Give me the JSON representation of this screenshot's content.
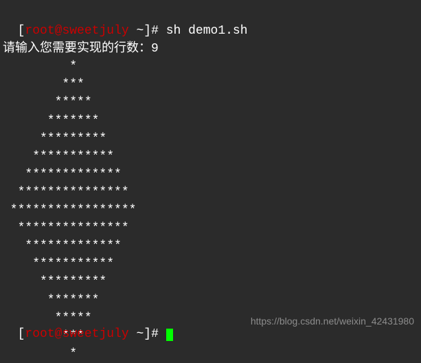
{
  "prompt": {
    "open_bracket": "[",
    "user": "root",
    "at": "@",
    "host": "sweetjuly",
    "space_path": " ~",
    "close_bracket": "]",
    "hash": "# "
  },
  "command": "sh demo1.sh",
  "input_prompt": "请输入您需要实现的行数：9",
  "pattern": {
    "lines": [
      "         *",
      "        ***",
      "       *****",
      "      *******",
      "     *********",
      "    ***********",
      "   *************",
      "  ***************",
      " *****************",
      "  ***************",
      "   *************",
      "    ***********",
      "     *********",
      "      *******",
      "       *****",
      "        ***",
      "         *"
    ]
  },
  "watermark": "https://blog.csdn.net/weixin_42431980"
}
